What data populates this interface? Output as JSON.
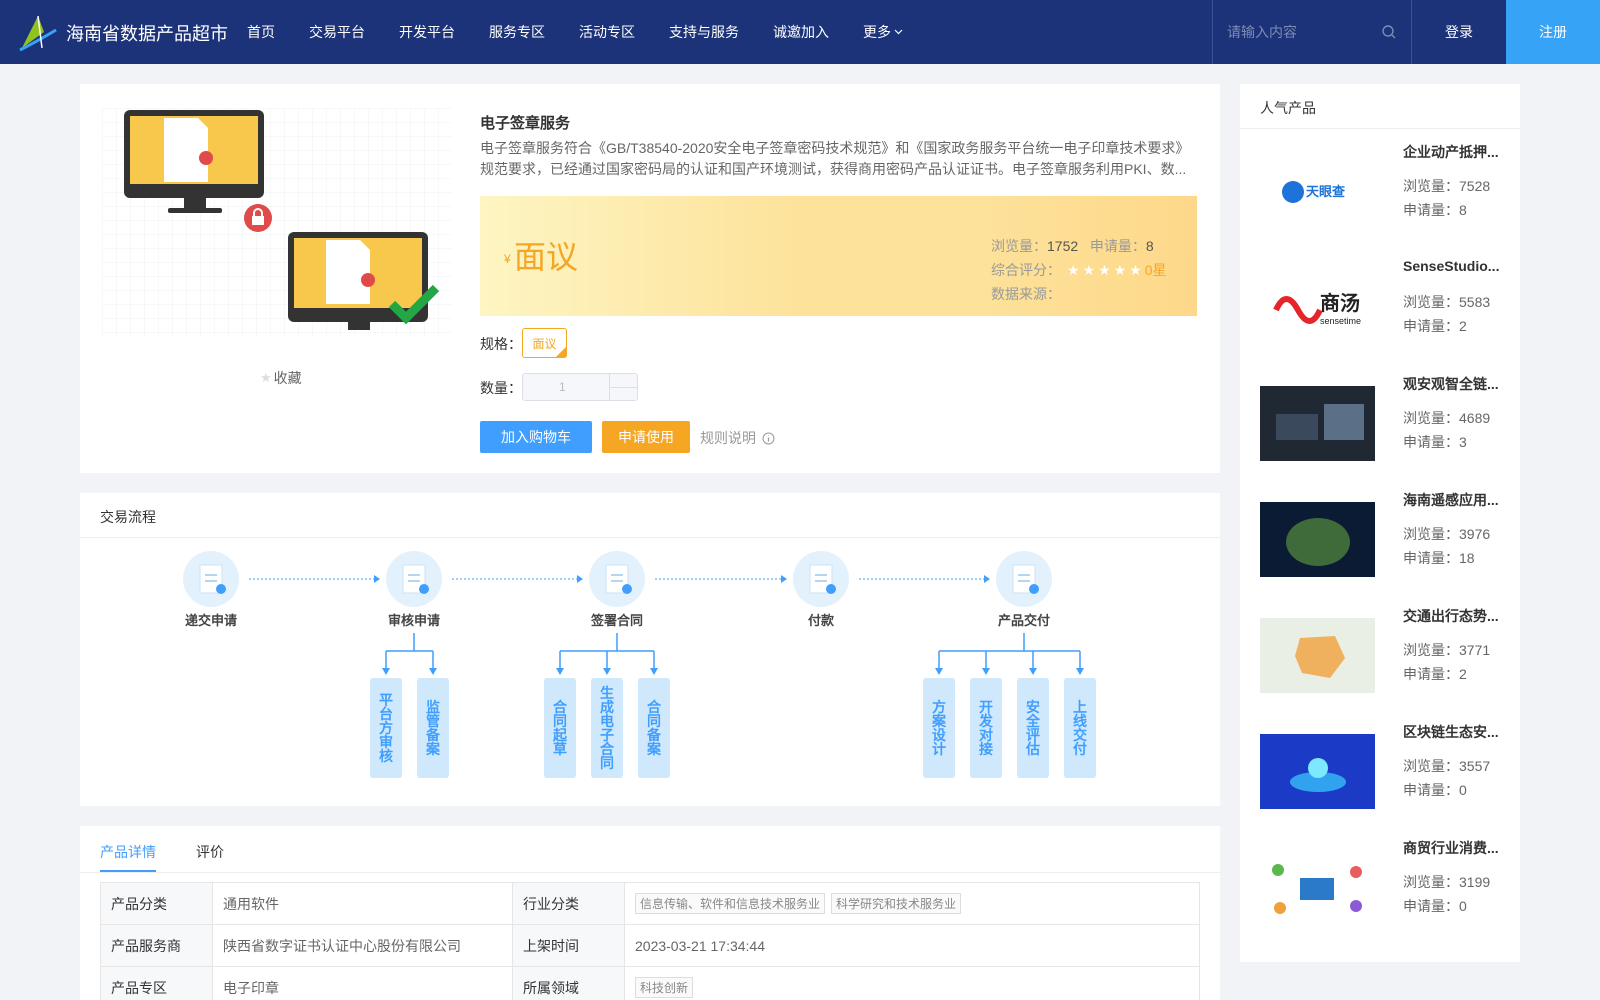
{
  "header": {
    "brand": "海南省数据产品超市",
    "nav": [
      "首页",
      "交易平台",
      "开发平台",
      "服务专区",
      "活动专区",
      "支持与服务",
      "诚邀加入",
      "更多"
    ],
    "search_placeholder": "请输入内容",
    "login": "登录",
    "register": "注册",
    "colors": {
      "bar": "#1c3279",
      "register": "#36a3f7"
    }
  },
  "product": {
    "title": "电子签章服务",
    "description": "电子签章服务符合《GB/T38540-2020安全电子签章密码技术规范》和《国家政务服务平台统一电子印章技术要求》规范要求，已经通过国家密码局的认证和国产环境测试，获得商用密码产品认证证书。电子签章服务利用PKI、数...",
    "favorite": "收藏",
    "price_symbol": "¥",
    "price": "面议",
    "views_label": "浏览量：",
    "views": "1752",
    "applies_label": "申请量：",
    "applies": "8",
    "rating_label": "综合评分：",
    "rating_text": "0星",
    "rating_value": 0,
    "source_label": "数据来源：",
    "spec_label": "规格：",
    "spec_value": "面议",
    "qty_label": "数量：",
    "qty_value": "1",
    "add_cart": "加入购物车",
    "apply": "申请使用",
    "rules": "规则说明"
  },
  "flow": {
    "title": "交易流程",
    "steps": [
      "递交申请",
      "审核申请",
      "签署合同",
      "付款",
      "产品交付"
    ],
    "sub_review": [
      "平台方审核",
      "监管备案"
    ],
    "sub_contract": [
      "合同起草",
      "生成电子合同",
      "合同备案"
    ],
    "sub_delivery": [
      "方案设计",
      "开发对接",
      "安全评估",
      "上线交付"
    ]
  },
  "detail": {
    "tabs": [
      "产品详情",
      "评价"
    ],
    "rows": [
      {
        "k1": "产品分类",
        "v1": "通用软件",
        "k2": "行业分类",
        "tags2": [
          "信息传输、软件和信息技术服务业",
          "科学研究和技术服务业"
        ]
      },
      {
        "k1": "产品服务商",
        "v1": "陕西省数字证书认证中心股份有限公司",
        "k2": "上架时间",
        "v2": "2023-03-21 17:34:44"
      },
      {
        "k1": "产品专区",
        "v1": "电子印章",
        "k2": "所属领域",
        "tags2": [
          "科技创新"
        ]
      }
    ]
  },
  "sidebar": {
    "title": "人气产品",
    "views_label": "浏览量：",
    "applies_label": "申请量：",
    "items": [
      {
        "name": "企业动产抵押...",
        "views": "7528",
        "applies": "8",
        "thumb": "tianyancha-logo"
      },
      {
        "name": "SenseStudio...",
        "views": "5583",
        "applies": "2",
        "thumb": "sensetime-logo"
      },
      {
        "name": "观安观智全链...",
        "views": "4689",
        "applies": "3",
        "thumb": "server-photo"
      },
      {
        "name": "海南遥感应用...",
        "views": "3976",
        "applies": "18",
        "thumb": "island-map"
      },
      {
        "name": "交通出行态势...",
        "views": "3771",
        "applies": "2",
        "thumb": "traffic-map"
      },
      {
        "name": "区块链生态安...",
        "views": "3557",
        "applies": "0",
        "thumb": "blockchain-art"
      },
      {
        "name": "商贸行业消费...",
        "views": "3199",
        "applies": "0",
        "thumb": "network-diagram"
      }
    ]
  }
}
